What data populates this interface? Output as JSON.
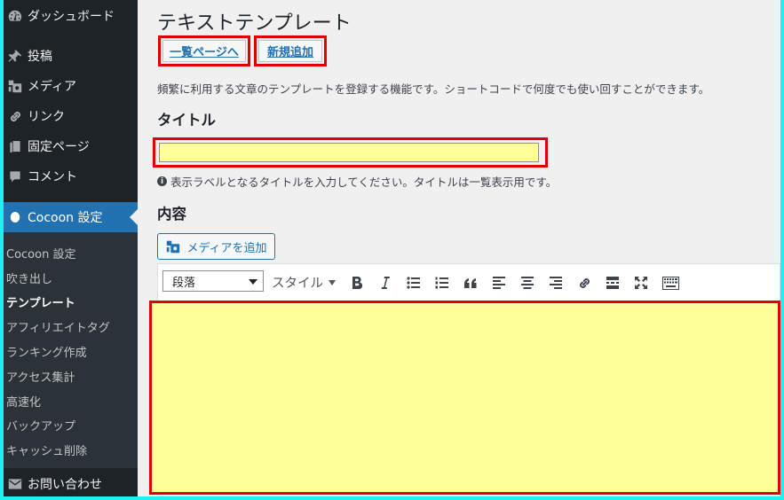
{
  "sidebar": {
    "items": [
      {
        "label": "ダッシュボード",
        "icon": "dashboard-icon"
      },
      {
        "label": "投稿",
        "icon": "pin-icon"
      },
      {
        "label": "メディア",
        "icon": "media-icon"
      },
      {
        "label": "リンク",
        "icon": "link-icon"
      },
      {
        "label": "固定ページ",
        "icon": "pages-icon"
      },
      {
        "label": "コメント",
        "icon": "comment-icon"
      },
      {
        "label": "Cocoon 設定",
        "icon": "cocoon-icon"
      }
    ],
    "submenu": [
      "Cocoon 設定",
      "吹き出し",
      "テンプレート",
      "アフィリエイトタグ",
      "ランキング作成",
      "アクセス集計",
      "高速化",
      "バックアップ",
      "キャッシュ削除"
    ],
    "bottom_item": {
      "label": "お問い合わせ",
      "icon": "mail-icon"
    }
  },
  "main": {
    "title": "テキストテンプレート",
    "list_button": "一覧ページへ",
    "new_button": "新規追加",
    "description": "頻繁に利用する文章のテンプレートを登録する機能です。ショートコードで何度でも使い回すことができます。",
    "title_label": "タイトル",
    "title_value": "",
    "title_help": "表示ラベルとなるタイトルを入力してください。タイトルは一覧表示用です。",
    "content_label": "内容",
    "add_media_button": "メディアを追加",
    "editor": {
      "format_select": "段落",
      "style_button": "スタイル"
    },
    "highlight_color": "#ffff99",
    "annotation_color": "#e00000"
  }
}
